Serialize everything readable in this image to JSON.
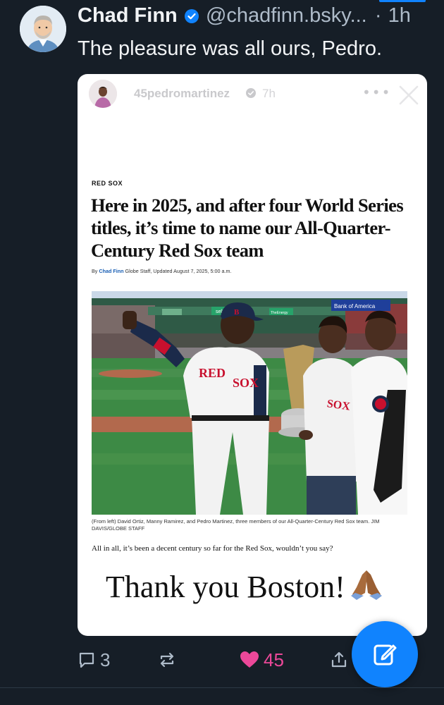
{
  "post": {
    "author_name": "Chad Finn",
    "handle": "@chadfinn.bsky...",
    "separator": "·",
    "time": "1h",
    "text": "The pleasure was all ours, Pedro."
  },
  "embed": {
    "ig_username": "45pedromartinez",
    "ig_time": "7h",
    "ig_more": "•••",
    "article": {
      "kicker": "RED SOX",
      "headline": "Here in 2025, and after four World Series titles, it’s time to name our All-Quarter-Century Red Sox team",
      "by_label": "By",
      "author": "Chad Finn",
      "byline_rest": "Globe Staff, Updated August 7, 2025, 5:00 a.m.",
      "photo_signs": [
        "seltoo",
        "TheEnergy",
        "Bank of America"
      ],
      "jersey_text": [
        "RED",
        "SOX",
        "SOX"
      ],
      "caption": "(From left) David Ortiz, Manny Ramirez, and Pedro Martinez, three members of our All-Quarter-Century Red Sox team. JIM DAVIS/GLOBE STAFF",
      "lede": "All in all, it’s been a decent century so far for the Red Sox, wouldn’t you say?"
    },
    "overlay_text": "Thank you Boston!"
  },
  "actions": {
    "reply_count": "3",
    "like_count": "45"
  },
  "colors": {
    "background": "#161e27",
    "accent": "#1083fe",
    "like": "#ec4899",
    "muted": "#aebbc9"
  }
}
